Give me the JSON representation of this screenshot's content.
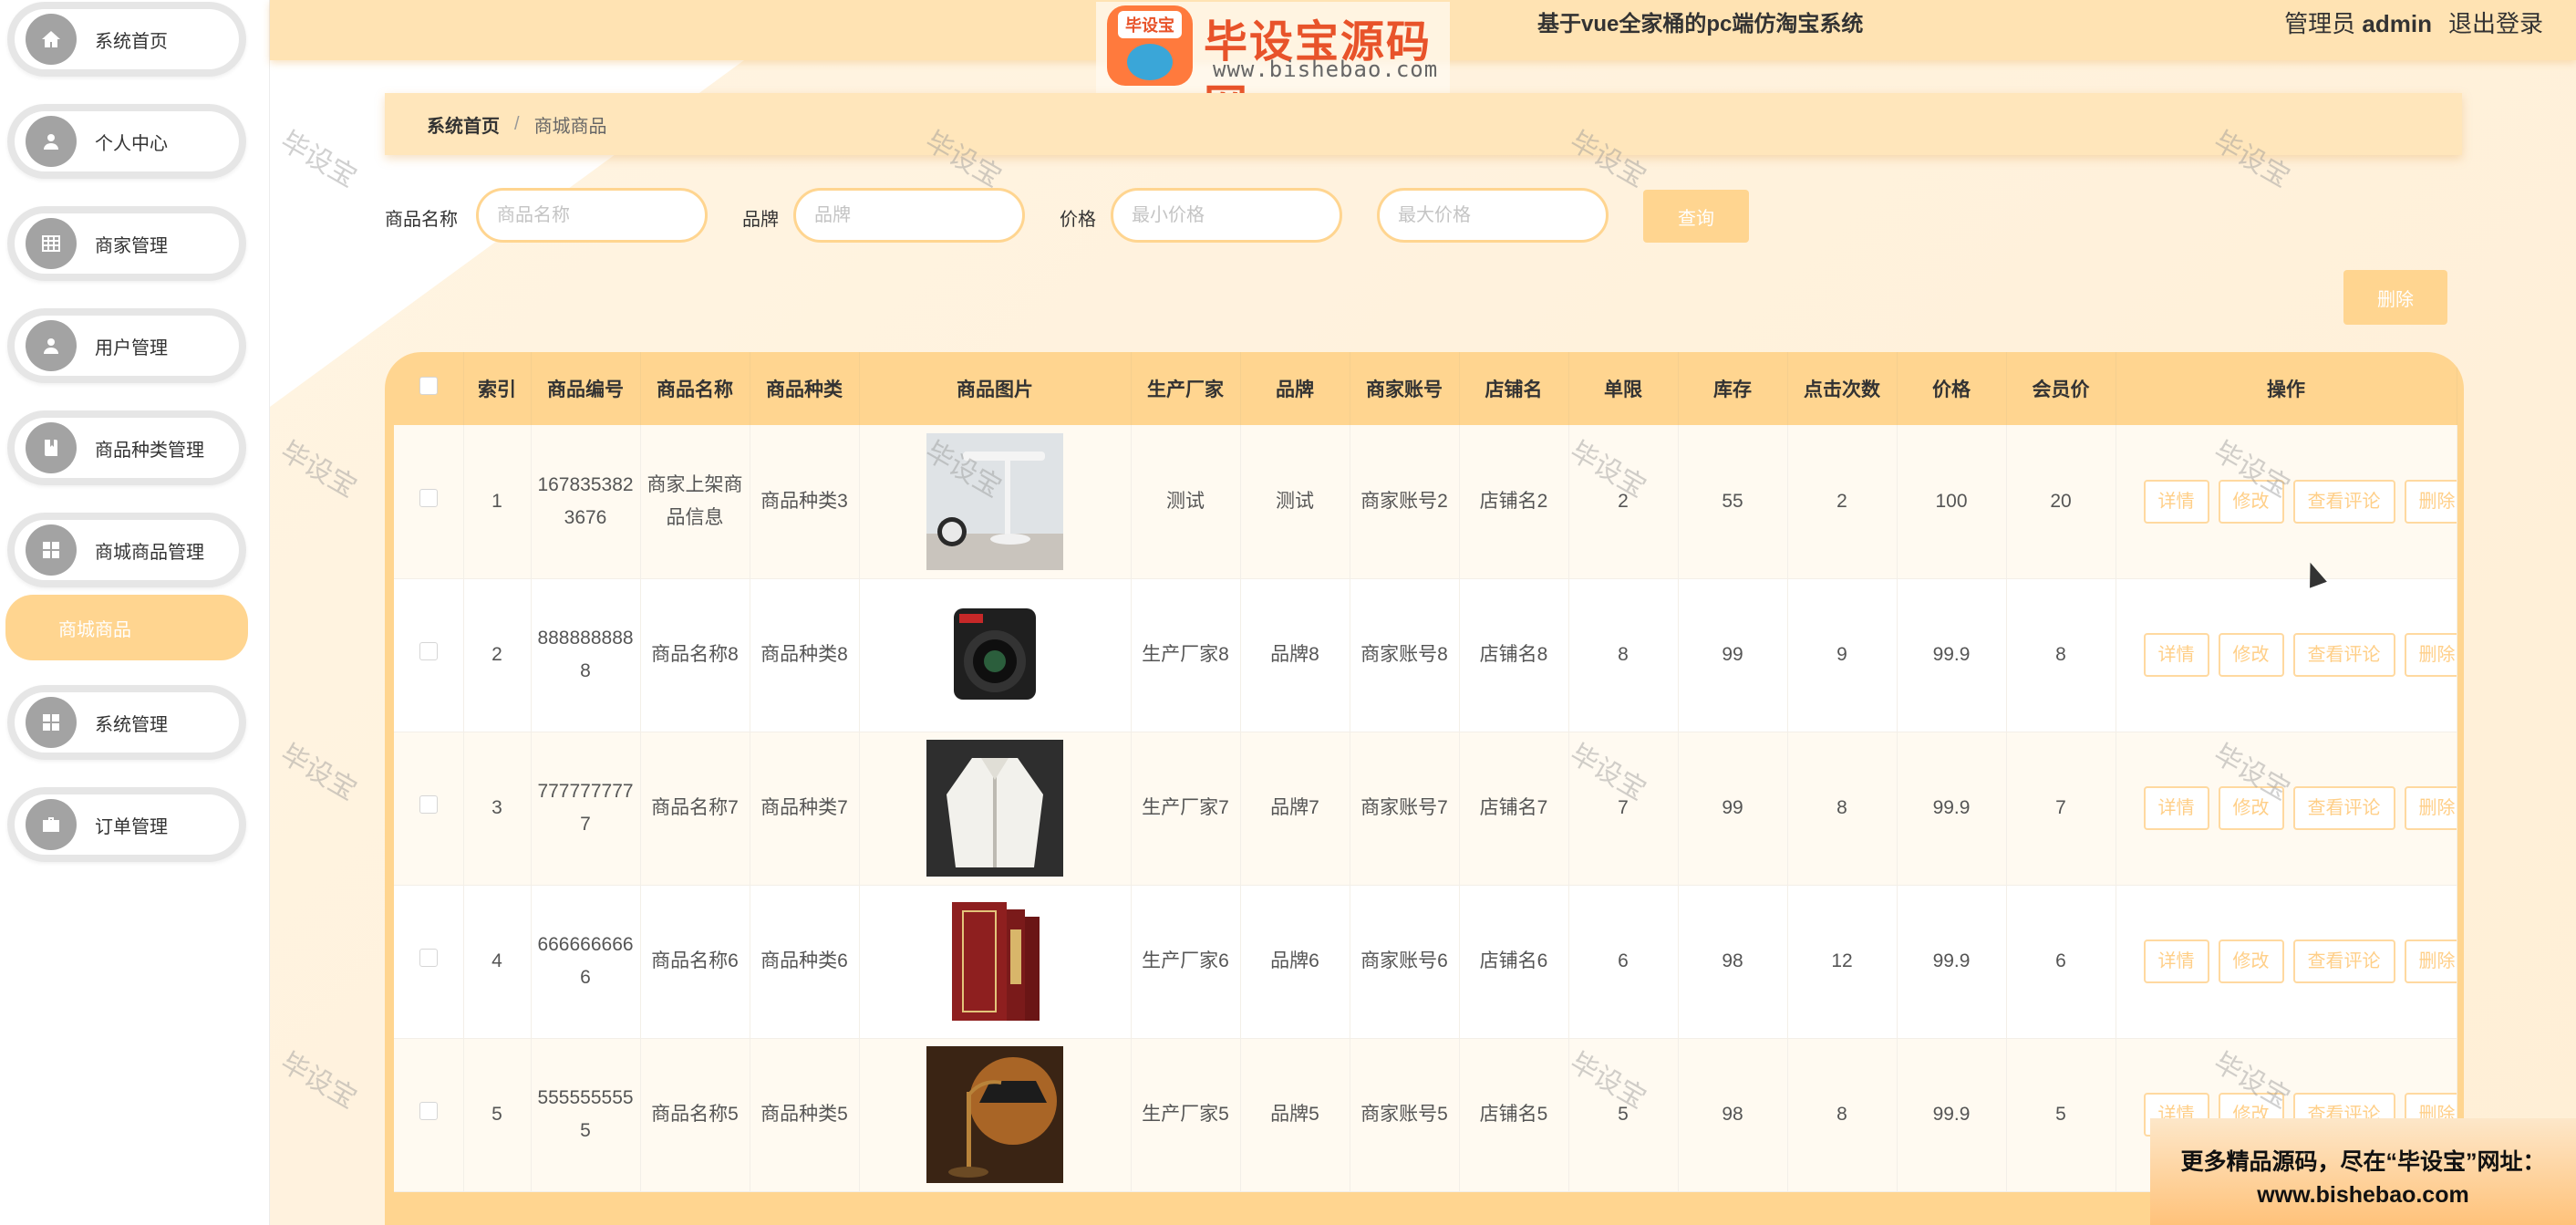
{
  "topbar": {
    "title": "基于vue全家桶的pc端仿淘宝系统",
    "user_role": "管理员",
    "user_name": "admin",
    "logout": "退出登录"
  },
  "logo": {
    "badge": "毕设宝",
    "text": "毕设宝源码网",
    "url": "www.bishebao.com"
  },
  "sidebar": {
    "items": [
      {
        "label": "系统首页",
        "icon": "home-icon"
      },
      {
        "label": "个人中心",
        "icon": "user-icon"
      },
      {
        "label": "商家管理",
        "icon": "table-icon"
      },
      {
        "label": "用户管理",
        "icon": "user-icon"
      },
      {
        "label": "商品种类管理",
        "icon": "book-icon"
      },
      {
        "label": "商城商品管理",
        "icon": "grid-icon"
      }
    ],
    "active": "商城商品",
    "items_after": [
      {
        "label": "系统管理",
        "icon": "grid-icon"
      },
      {
        "label": "订单管理",
        "icon": "briefcase-icon"
      }
    ]
  },
  "breadcrumb": {
    "home": "系统首页",
    "separator": "/",
    "current": "商城商品"
  },
  "search": {
    "name_label": "商品名称",
    "name_placeholder": "商品名称",
    "brand_label": "品牌",
    "brand_placeholder": "品牌",
    "price_label": "价格",
    "min_placeholder": "最小价格",
    "max_placeholder": "最大价格",
    "query_button": "查询"
  },
  "delete_button": "删除",
  "table": {
    "headers": [
      "",
      "索引",
      "商品编号",
      "商品名称",
      "商品种类",
      "商品图片",
      "生产厂家",
      "品牌",
      "商家账号",
      "店铺名",
      "单限",
      "库存",
      "点击次数",
      "价格",
      "会员价",
      "操作"
    ],
    "op_buttons": [
      "详情",
      "修改",
      "查看评论",
      "删除"
    ],
    "rows": [
      {
        "index": "1",
        "code": "1678353823676",
        "name": "商家上架商品信息",
        "category": "商品种类3",
        "image": "desk-lamp",
        "maker": "测试",
        "brand": "测试",
        "account": "商家账号2",
        "shop": "店铺名2",
        "limit": "2",
        "stock": "55",
        "clicks": "2",
        "price": "100",
        "member_price": "20"
      },
      {
        "index": "2",
        "code": "8888888888",
        "name": "商品名称8",
        "category": "商品种类8",
        "image": "camera",
        "maker": "生产厂家8",
        "brand": "品牌8",
        "account": "商家账号8",
        "shop": "店铺名8",
        "limit": "8",
        "stock": "99",
        "clicks": "9",
        "price": "99.9",
        "member_price": "8"
      },
      {
        "index": "3",
        "code": "7777777777",
        "name": "商品名称7",
        "category": "商品种类7",
        "image": "jacket",
        "maker": "生产厂家7",
        "brand": "品牌7",
        "account": "商家账号7",
        "shop": "店铺名7",
        "limit": "7",
        "stock": "99",
        "clicks": "8",
        "price": "99.9",
        "member_price": "7"
      },
      {
        "index": "4",
        "code": "6666666666",
        "name": "商品名称6",
        "category": "商品种类6",
        "image": "books",
        "maker": "生产厂家6",
        "brand": "品牌6",
        "account": "商家账号6",
        "shop": "店铺名6",
        "limit": "6",
        "stock": "98",
        "clicks": "12",
        "price": "99.9",
        "member_price": "6"
      },
      {
        "index": "5",
        "code": "5555555555",
        "name": "商品名称5",
        "category": "商品种类5",
        "image": "vintage-lamp",
        "maker": "生产厂家5",
        "brand": "品牌5",
        "account": "商家账号5",
        "shop": "店铺名5",
        "limit": "5",
        "stock": "98",
        "clicks": "8",
        "price": "99.9",
        "member_price": "5"
      }
    ]
  },
  "watermark": "毕设宝",
  "promo": {
    "line1": "更多精品源码，尽在“毕设宝”网址：",
    "line2": "www.bishebao.com"
  },
  "colors": {
    "accent": "#ffd590",
    "topbar": "#ffe3b3",
    "sidebar_icon": "#a3a3a3"
  }
}
